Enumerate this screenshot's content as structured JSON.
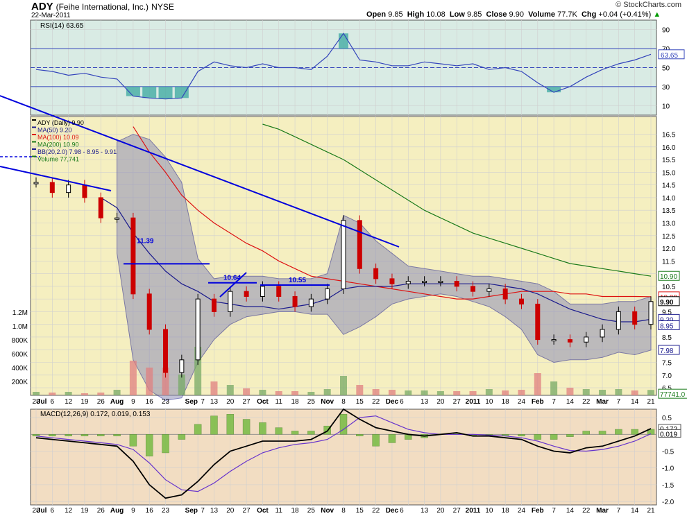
{
  "header": {
    "ticker": "ADY",
    "company": "(Feihe International, Inc.)",
    "exchange": "NYSE",
    "date": "22-Mar-2011",
    "open_label": "Open",
    "open": "9.85",
    "high_label": "High",
    "high": "10.08",
    "low_label": "Low",
    "low": "9.85",
    "close_label": "Close",
    "close": "9.90",
    "volume_label": "Volume",
    "volume": "77.7K",
    "chg_label": "Chg",
    "chg": "+0.04 (+0.41%)",
    "logo": "© StockCharts.com"
  },
  "colors": {
    "price_bg": "#f5efc0",
    "rsi_bg": "#d9ebe4",
    "macd_bg": "#f2ddc2",
    "up": "#000000",
    "down": "#cc0000",
    "ma50": "#1a1a8c",
    "ma100": "#dd1111",
    "ma200": "#1a7a1a",
    "bb_fill": "#8f8fb8",
    "trendline": "#0000dd",
    "rsi_line": "#3344bb",
    "macd_line": "#000000",
    "signal_line": "#6633cc",
    "hist": "#77bb44"
  },
  "chart_data": [
    {
      "type": "line",
      "panel": "rsi",
      "title": "RSI(14) 63.65",
      "ylim": [
        0,
        100
      ],
      "ticks": [
        "90",
        "70",
        "50",
        "30",
        "10"
      ],
      "tick_values": [
        90,
        70,
        50,
        30,
        10
      ],
      "last_label": "63.65",
      "x": [
        "Jun 28",
        "Jul 6",
        "Jul 12",
        "Jul 19",
        "Jul 26",
        "Aug 2",
        "Aug 9",
        "Aug 16",
        "Aug 23",
        "Sep 1",
        "Sep 7",
        "Sep 13",
        "Sep 20",
        "Sep 27",
        "Oct 1",
        "Oct 11",
        "Oct 18",
        "Oct 25",
        "Nov 1",
        "Nov 8",
        "Nov 15",
        "Nov 22",
        "Dec 1",
        "Dec 6",
        "Dec 13",
        "Dec 20",
        "Dec 27",
        "Jan 3",
        "Jan 10",
        "Jan 18",
        "Jan 24",
        "Feb 1",
        "Feb 7",
        "Feb 14",
        "Feb 22",
        "Mar 1",
        "Mar 7",
        "Mar 14",
        "Mar 21"
      ],
      "values": [
        48,
        46,
        42,
        44,
        40,
        38,
        20,
        18,
        17,
        18,
        46,
        56,
        52,
        50,
        54,
        50,
        50,
        48,
        62,
        86,
        58,
        56,
        52,
        52,
        56,
        54,
        52,
        54,
        48,
        50,
        46,
        34,
        24,
        30,
        40,
        48,
        54,
        58,
        64
      ]
    },
    {
      "type": "candlestick",
      "panel": "price",
      "title": "ADY (Daily) 9.90",
      "legend": [
        "MA(50) 9.20",
        "MA(100) 10.09",
        "MA(200) 10.90",
        "BB(20,2.0) 7.98 - 8.95 - 9.91",
        "Volume 77,741"
      ],
      "ylim": [
        6.2,
        17.2
      ],
      "ticks": [
        "16.5",
        "16.0",
        "15.5",
        "15.0",
        "14.5",
        "14.0",
        "13.5",
        "13.0",
        "12.5",
        "12.0",
        "11.5",
        "11.0",
        "10.5",
        "10.0",
        "9.5",
        "9.0",
        "8.5",
        "8.0",
        "7.5",
        "7.0",
        "6.5"
      ],
      "tick_values": [
        16.5,
        16.0,
        15.5,
        15.0,
        14.5,
        14.0,
        13.5,
        13.0,
        12.5,
        12.0,
        11.5,
        11.0,
        10.5,
        10.0,
        9.5,
        9.0,
        8.5,
        8.0,
        7.5,
        7.0,
        6.5
      ],
      "vol_ticks": [
        "1.2M",
        "1.0M",
        "800K",
        "600K",
        "400K",
        "200K"
      ],
      "vol_tick_values": [
        1200000,
        1000000,
        800000,
        600000,
        400000,
        200000
      ],
      "right_labels": [
        {
          "text": "10.90",
          "value": 10.9,
          "color": "#1a7a1a"
        },
        {
          "text": "10.09",
          "value": 10.09,
          "color": "#dd1111"
        },
        {
          "text": "9.90",
          "value": 9.9,
          "color": "#000000"
        },
        {
          "text": "9.20",
          "value": 9.2,
          "color": "#1a1a8c"
        },
        {
          "text": "8.95",
          "value": 8.95,
          "color": "#1a1a8c"
        },
        {
          "text": "7.98",
          "value": 7.98,
          "color": "#1a1a8c"
        },
        {
          "text": "77741.0",
          "value": 6.25,
          "color": "#1a7a1a"
        }
      ],
      "annotations": [
        {
          "text": "11.39",
          "value": 11.39
        },
        {
          "text": "10.64",
          "value": 10.64
        },
        {
          "text": "10.55",
          "value": 10.55
        }
      ],
      "x": [
        "Jun 28",
        "Jul 6",
        "Jul 12",
        "Jul 19",
        "Jul 26",
        "Aug 2",
        "Aug 9",
        "Aug 16",
        "Aug 23",
        "Sep 1",
        "Sep 7",
        "Sep 13",
        "Sep 20",
        "Sep 27",
        "Oct 1",
        "Oct 11",
        "Oct 18",
        "Oct 25",
        "Nov 1",
        "Nov 8",
        "Nov 15",
        "Nov 22",
        "Dec 1",
        "Dec 6",
        "Dec 13",
        "Dec 20",
        "Dec 27",
        "Jan 3",
        "Jan 10",
        "Jan 18",
        "Jan 24",
        "Feb 1",
        "Feb 7",
        "Feb 14",
        "Feb 22",
        "Mar 1",
        "Mar 7",
        "Mar 14",
        "Mar 21"
      ],
      "close": [
        14.6,
        14.2,
        14.5,
        14.0,
        13.2,
        13.2,
        10.2,
        8.8,
        7.1,
        7.6,
        10.0,
        9.5,
        10.3,
        10.1,
        10.5,
        10.1,
        9.7,
        10.0,
        10.4,
        13.1,
        11.2,
        10.8,
        10.6,
        10.7,
        10.7,
        10.7,
        10.5,
        10.3,
        10.4,
        10.0,
        9.8,
        8.4,
        8.4,
        8.3,
        8.5,
        8.8,
        9.5,
        9.0,
        9.9
      ],
      "ma50": [
        null,
        null,
        null,
        null,
        14.0,
        13.6,
        12.6,
        11.8,
        11.1,
        10.6,
        10.3,
        9.9,
        9.8,
        9.7,
        9.7,
        9.6,
        9.7,
        9.8,
        10.0,
        10.4,
        10.5,
        10.5,
        10.5,
        10.6,
        10.6,
        10.6,
        10.6,
        10.6,
        10.6,
        10.5,
        10.4,
        10.2,
        9.9,
        9.6,
        9.4,
        9.2,
        9.1,
        9.1,
        9.2
      ],
      "ma100": [
        null,
        null,
        null,
        null,
        null,
        null,
        16.8,
        15.8,
        15.0,
        14.1,
        13.5,
        13.0,
        12.6,
        12.2,
        11.9,
        11.5,
        11.2,
        10.9,
        10.8,
        10.7,
        10.6,
        10.5,
        10.4,
        10.3,
        10.2,
        10.1,
        10.0,
        10.0,
        10.1,
        10.2,
        10.3,
        10.3,
        10.3,
        10.2,
        10.2,
        10.1,
        10.1,
        10.1,
        10.09
      ],
      "ma200": [
        null,
        null,
        null,
        null,
        null,
        null,
        null,
        null,
        null,
        null,
        null,
        null,
        null,
        null,
        16.9,
        16.7,
        16.4,
        16.1,
        15.8,
        15.5,
        15.1,
        14.7,
        14.3,
        13.9,
        13.5,
        13.2,
        12.9,
        12.6,
        12.4,
        12.2,
        12.0,
        11.8,
        11.6,
        11.4,
        11.3,
        11.2,
        11.1,
        11.0,
        10.9
      ],
      "bb_upper": [
        null,
        null,
        null,
        null,
        null,
        16.2,
        16.5,
        16.3,
        15.6,
        14.6,
        11.6,
        10.8,
        10.9,
        10.9,
        10.9,
        10.8,
        10.8,
        10.8,
        11.0,
        13.3,
        13.0,
        12.3,
        11.8,
        11.3,
        11.2,
        11.1,
        11.0,
        10.9,
        10.9,
        10.8,
        10.7,
        10.6,
        10.3,
        9.8,
        9.8,
        9.8,
        9.9,
        9.9,
        10.1
      ],
      "bb_lower": [
        null,
        null,
        null,
        null,
        null,
        11.8,
        7.6,
        6.4,
        6.0,
        6.1,
        7.5,
        8.4,
        9.0,
        9.3,
        9.4,
        9.5,
        9.5,
        9.4,
        9.4,
        8.6,
        8.9,
        9.3,
        9.8,
        10.0,
        10.1,
        10.2,
        10.1,
        9.9,
        9.7,
        9.3,
        8.8,
        7.8,
        7.5,
        7.6,
        7.6,
        7.7,
        7.9,
        7.8,
        7.98
      ],
      "volume": [
        50000,
        40000,
        50000,
        30000,
        40000,
        80000,
        500000,
        400000,
        400000,
        300000,
        700000,
        200000,
        150000,
        100000,
        80000,
        60000,
        60000,
        50000,
        90000,
        280000,
        150000,
        90000,
        80000,
        70000,
        70000,
        60000,
        60000,
        60000,
        90000,
        70000,
        80000,
        320000,
        200000,
        110000,
        90000,
        80000,
        90000,
        70000,
        77741
      ]
    },
    {
      "type": "line",
      "panel": "macd",
      "title": "MACD(12,26,9) 0.172, 0.019, 0.153",
      "ylim": [
        -2.1,
        0.75
      ],
      "ticks": [
        "0.5",
        "-0.5",
        "-1.0",
        "-1.5",
        "-2.0"
      ],
      "tick_values": [
        0.5,
        -0.5,
        -1.0,
        -1.5,
        -2.0
      ],
      "right_labels": [
        {
          "text": "0.172",
          "value": 0.172
        },
        {
          "text": "0.019",
          "value": 0.019
        }
      ],
      "x": [
        "Jun 28",
        "Jul 6",
        "Jul 12",
        "Jul 19",
        "Jul 26",
        "Aug 2",
        "Aug 9",
        "Aug 16",
        "Aug 23",
        "Sep 1",
        "Sep 7",
        "Sep 13",
        "Sep 20",
        "Sep 27",
        "Oct 1",
        "Oct 11",
        "Oct 18",
        "Oct 25",
        "Nov 1",
        "Nov 8",
        "Nov 15",
        "Nov 22",
        "Dec 1",
        "Dec 6",
        "Dec 13",
        "Dec 20",
        "Dec 27",
        "Jan 3",
        "Jan 10",
        "Jan 18",
        "Jan 24",
        "Feb 1",
        "Feb 7",
        "Feb 14",
        "Feb 22",
        "Mar 1",
        "Mar 7",
        "Mar 14",
        "Mar 21"
      ],
      "series": [
        {
          "values": [
            -0.1,
            -0.15,
            -0.2,
            -0.25,
            -0.3,
            -0.35,
            -0.8,
            -1.5,
            -1.9,
            -1.8,
            -1.4,
            -0.9,
            -0.5,
            -0.35,
            -0.2,
            -0.2,
            -0.2,
            -0.15,
            0.1,
            0.75,
            0.45,
            0.2,
            0.1,
            0.0,
            -0.05,
            0.0,
            0.05,
            -0.05,
            -0.05,
            -0.1,
            -0.15,
            -0.35,
            -0.5,
            -0.55,
            -0.4,
            -0.35,
            -0.2,
            -0.05,
            0.172
          ]
        },
        {
          "values": [
            -0.05,
            -0.1,
            -0.15,
            -0.2,
            -0.25,
            -0.3,
            -0.45,
            -0.85,
            -1.35,
            -1.65,
            -1.7,
            -1.45,
            -1.1,
            -0.8,
            -0.55,
            -0.4,
            -0.3,
            -0.25,
            -0.15,
            0.15,
            0.5,
            0.55,
            0.35,
            0.15,
            0.05,
            0.0,
            0.0,
            0.0,
            -0.02,
            -0.05,
            -0.1,
            -0.2,
            -0.35,
            -0.48,
            -0.5,
            -0.45,
            -0.35,
            -0.2,
            0.019
          ]
        },
        {
          "values": [
            -0.05,
            -0.05,
            -0.05,
            -0.05,
            -0.05,
            -0.05,
            -0.35,
            -0.65,
            -0.55,
            -0.15,
            0.3,
            0.55,
            0.6,
            0.45,
            0.35,
            0.2,
            0.1,
            0.1,
            0.25,
            0.6,
            -0.05,
            -0.35,
            -0.25,
            -0.15,
            -0.1,
            0.0,
            0.05,
            -0.05,
            -0.03,
            -0.05,
            -0.05,
            -0.15,
            -0.15,
            -0.07,
            0.1,
            0.1,
            0.15,
            0.15,
            0.153
          ]
        }
      ]
    }
  ],
  "x_axis": {
    "labels": [
      {
        "text": "28",
        "i": 0
      },
      {
        "text": "Jul",
        "i": 0.35,
        "bold": true
      },
      {
        "text": "6",
        "i": 1
      },
      {
        "text": "12",
        "i": 2
      },
      {
        "text": "19",
        "i": 3
      },
      {
        "text": "26",
        "i": 4
      },
      {
        "text": "Aug",
        "i": 5,
        "bold": true
      },
      {
        "text": "9",
        "i": 6
      },
      {
        "text": "16",
        "i": 7
      },
      {
        "text": "23",
        "i": 8
      },
      {
        "text": "Sep",
        "i": 9.6,
        "bold": true
      },
      {
        "text": "7",
        "i": 10.3
      },
      {
        "text": "13",
        "i": 11
      },
      {
        "text": "20",
        "i": 12
      },
      {
        "text": "27",
        "i": 13
      },
      {
        "text": "Oct",
        "i": 14,
        "bold": true
      },
      {
        "text": "11",
        "i": 15
      },
      {
        "text": "18",
        "i": 16
      },
      {
        "text": "25",
        "i": 17
      },
      {
        "text": "Nov",
        "i": 18,
        "bold": true
      },
      {
        "text": "8",
        "i": 19
      },
      {
        "text": "15",
        "i": 20
      },
      {
        "text": "22",
        "i": 21
      },
      {
        "text": "Dec",
        "i": 22,
        "bold": true
      },
      {
        "text": "6",
        "i": 22.6
      },
      {
        "text": "13",
        "i": 24
      },
      {
        "text": "20",
        "i": 25
      },
      {
        "text": "27",
        "i": 26
      },
      {
        "text": "2011",
        "i": 27,
        "bold": true
      },
      {
        "text": "10",
        "i": 28
      },
      {
        "text": "18",
        "i": 29
      },
      {
        "text": "24",
        "i": 30
      },
      {
        "text": "Feb",
        "i": 31,
        "bold": true
      },
      {
        "text": "7",
        "i": 32
      },
      {
        "text": "14",
        "i": 33
      },
      {
        "text": "22",
        "i": 34
      },
      {
        "text": "Mar",
        "i": 35,
        "bold": true
      },
      {
        "text": "7",
        "i": 36
      },
      {
        "text": "14",
        "i": 37
      },
      {
        "text": "21",
        "i": 38
      }
    ]
  }
}
